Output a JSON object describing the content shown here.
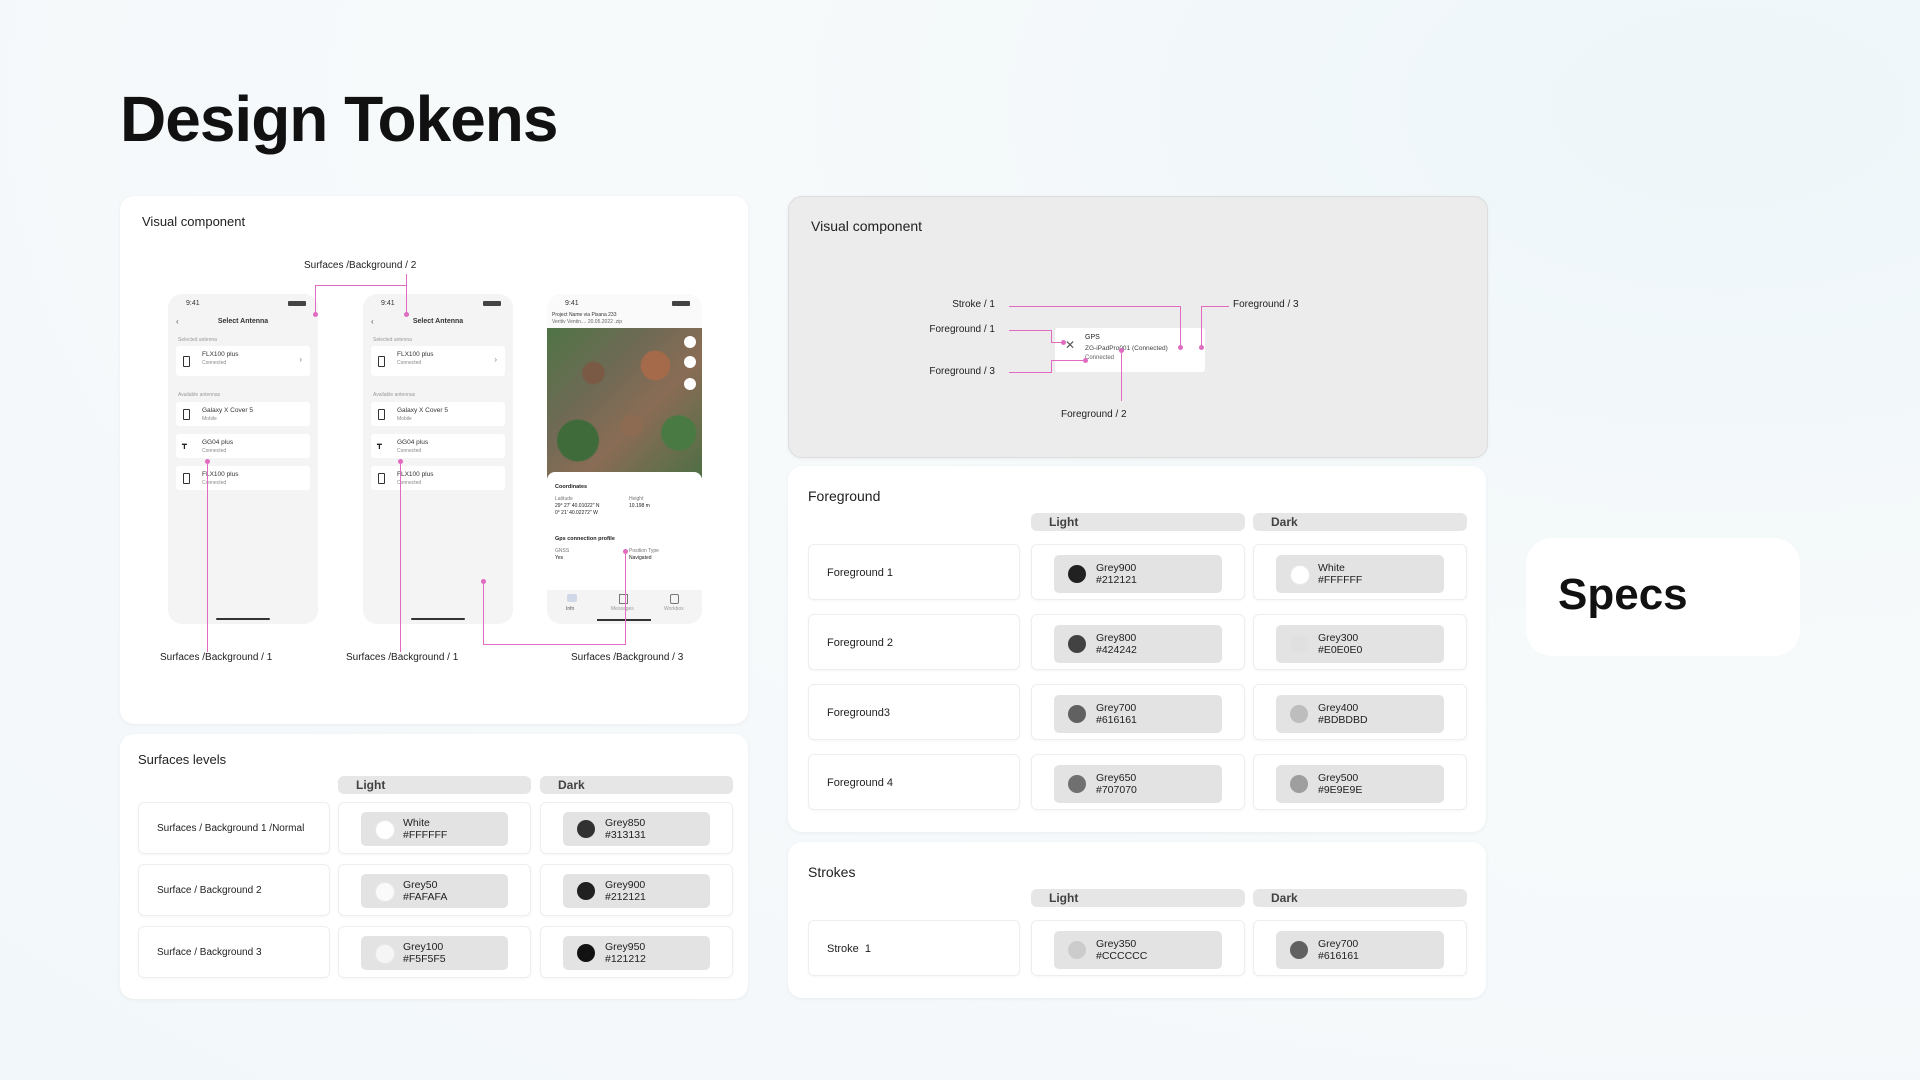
{
  "page": {
    "title": "Design Tokens",
    "specs_label": "Specs"
  },
  "left_visual": {
    "title": "Visual component",
    "annotations": {
      "top": "Surfaces /Background / 2",
      "bottom_1": "Surfaces /Background / 1",
      "bottom_2": "Surfaces /Background / 1",
      "bottom_3": "Surfaces /Background / 3"
    },
    "phone_a": {
      "time": "9:41",
      "title": "Select Antenna",
      "selected_label": "Selected antenna",
      "available_label": "Available antennas",
      "items": [
        {
          "name": "FLX100 plus",
          "sub": "Connected"
        },
        {
          "name": "Galaxy X Cover 5",
          "sub": "Mobile"
        },
        {
          "name": "GG04 plus",
          "sub": "Connected"
        },
        {
          "name": "FLX100 plus",
          "sub": "Connected"
        }
      ]
    },
    "phone_b": {
      "time": "9:41",
      "title": "Select Antenna",
      "selected_label": "Selected antenna",
      "available_label": "Available antennas",
      "items": [
        {
          "name": "FLX100 plus",
          "sub": "Connected"
        },
        {
          "name": "Galaxy X Cover 5",
          "sub": "Mobile"
        },
        {
          "name": "GG04 plus",
          "sub": "Connected"
        },
        {
          "name": "FLX100 plus",
          "sub": "Connected"
        }
      ]
    },
    "phone_c": {
      "time": "9:41",
      "project": "Project Name via Pisana 233",
      "project_sub": "Veritiv Ventin.... 20.05.2022 .zip",
      "coords_title": "Coordinates",
      "latitude_label": "Latitude",
      "latitude_value": "29° 27' 40.01022\" N",
      "longitude_value": "0° 21' 40.02272\" W",
      "height_label": "Height",
      "height_value": "10.198 m",
      "gps_title": "Gps connection profile",
      "gnss_label": "GNSS",
      "gnss_value": "Yes",
      "position_label": "Position Type",
      "position_value": "Navigated",
      "tabs": [
        "Info",
        "Messages",
        "Workbox"
      ]
    }
  },
  "right_visual": {
    "title": "Visual component",
    "labels": {
      "stroke1": "Stroke / 1",
      "fg1": "Foreground / 1",
      "fg3_left": "Foreground / 3",
      "fg3_right": "Foreground / 3",
      "fg2": "Foreground / 2"
    },
    "sample": {
      "title": "GPS",
      "device": "ZG-iPadPro001 (Connected)",
      "status": "Connected"
    }
  },
  "surfaces": {
    "title": "Surfaces levels",
    "col_light": "Light",
    "col_dark": "Dark",
    "rows": [
      {
        "label": "Surfaces / Background 1 /Normal",
        "light": {
          "name": "White",
          "hex": "#FFFFFF",
          "color": "#FFFFFF"
        },
        "dark": {
          "name": "Grey850",
          "hex": "#313131",
          "color": "#313131"
        }
      },
      {
        "label": "Surface / Background 2",
        "light": {
          "name": "Grey50",
          "hex": "#FAFAFA",
          "color": "#FAFAFA"
        },
        "dark": {
          "name": "Grey900",
          "hex": "#212121",
          "color": "#212121"
        }
      },
      {
        "label": "Surface / Background 3",
        "light": {
          "name": "Grey100",
          "hex": "#F5F5F5",
          "color": "#F5F5F5"
        },
        "dark": {
          "name": "Grey950",
          "hex": "#121212",
          "color": "#121212"
        }
      }
    ]
  },
  "foreground": {
    "title": "Foreground",
    "col_light": "Light",
    "col_dark": "Dark",
    "rows": [
      {
        "label": "Foreground 1",
        "light": {
          "name": "Grey900",
          "hex": "#212121",
          "color": "#212121"
        },
        "dark": {
          "name": "White",
          "hex": "#FFFFFF",
          "color": "#FFFFFF"
        }
      },
      {
        "label": "Foreground 2",
        "light": {
          "name": "Grey800",
          "hex": "#424242",
          "color": "#424242"
        },
        "dark": {
          "name": "Grey300",
          "hex": "#E0E0E0",
          "color": "#E0E0E0"
        }
      },
      {
        "label": "Foreground3",
        "light": {
          "name": "Grey700",
          "hex": "#616161",
          "color": "#616161"
        },
        "dark": {
          "name": "Grey400",
          "hex": "#BDBDBD",
          "color": "#BDBDBD"
        }
      },
      {
        "label": "Foreground 4",
        "light": {
          "name": "Grey650",
          "hex": "#707070",
          "color": "#707070"
        },
        "dark": {
          "name": "Grey500",
          "hex": "#9E9E9E",
          "color": "#9E9E9E"
        }
      }
    ]
  },
  "strokes": {
    "title": "Strokes",
    "col_light": "Light",
    "col_dark": "Dark",
    "rows": [
      {
        "label": "Stroke  1",
        "light": {
          "name": "Grey350",
          "hex": "#CCCCCC",
          "color": "#CCCCCC"
        },
        "dark": {
          "name": "Grey700",
          "hex": "#616161",
          "color": "#616161"
        }
      }
    ]
  },
  "colors": {
    "annotation": "#E06BC0"
  }
}
